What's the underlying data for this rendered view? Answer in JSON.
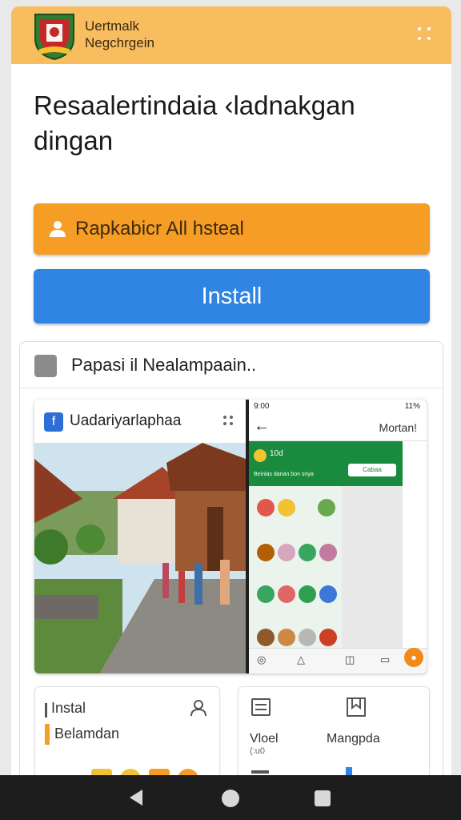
{
  "header": {
    "title_line1": "Uertmalk",
    "title_line2": "Negchrgein",
    "logo_icon": "crest-icon",
    "menu_icon": "grid-dots-icon",
    "background_color": "#f8bd5e"
  },
  "main": {
    "headline": "Resaalertindaia ‹ladnakgan dingan",
    "primary_button": {
      "label": "Rapkabicr All hsteal",
      "icon": "person-icon",
      "color": "#f59d24"
    },
    "install_button": {
      "label": "Install",
      "color": "#2f84e4"
    }
  },
  "section": {
    "title": "Papasi il Nealampaain..",
    "icon": "checkbox-icon",
    "preview": {
      "title": "Uadariyarlaphaa",
      "app_icon_glyph": "f",
      "phone": {
        "status_time": "9:00",
        "status_right": "11%",
        "nav_title": "Mortan!",
        "store_title": "10d",
        "store_line": "Beinlas darian bon sriya",
        "side_button": "Cabaa"
      }
    },
    "mini_left": {
      "label1": "Instal",
      "label2": "Belamdan"
    },
    "mini_right": {
      "label1": "Vloel",
      "label1_sub": "(:u0",
      "label2": "Mangpda"
    }
  },
  "nav": {
    "back_icon": "back-triangle-icon",
    "home_icon": "home-circle-icon",
    "recent_icon": "recents-square-icon"
  }
}
